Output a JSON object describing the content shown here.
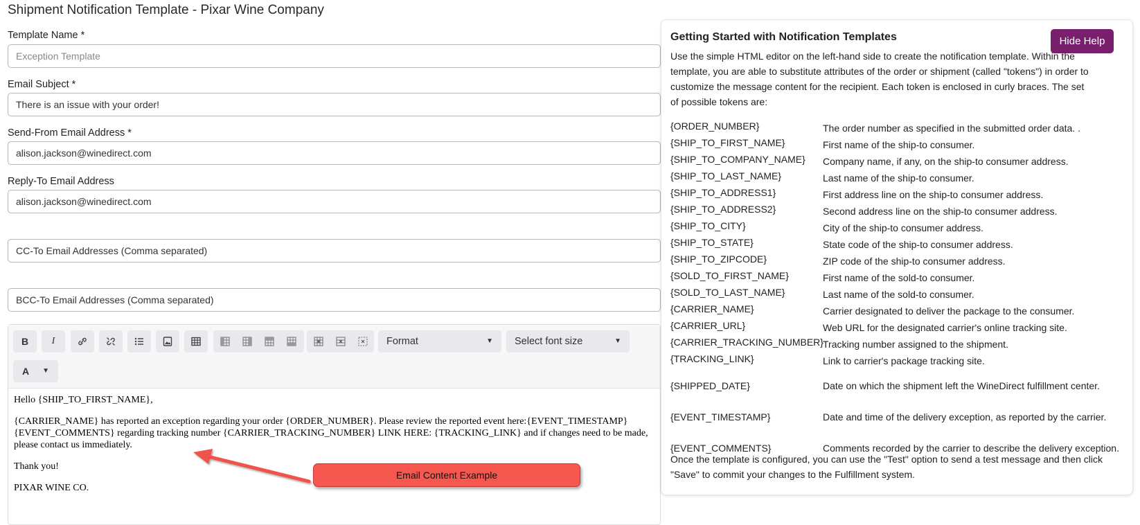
{
  "page": {
    "title": "Shipment Notification Template - Pixar Wine Company"
  },
  "form": {
    "template_name": {
      "label": "Template Name *",
      "placeholder": "Exception Template"
    },
    "email_subject": {
      "label": "Email Subject *",
      "value": "There is an issue with your order!"
    },
    "send_from": {
      "label": "Send-From Email Address *",
      "value": "alison.jackson@winedirect.com"
    },
    "reply_to": {
      "label": "Reply-To Email Address",
      "value": "alison.jackson@winedirect.com"
    },
    "cc": {
      "placeholder": "CC-To Email Addresses (Comma separated)"
    },
    "bcc": {
      "placeholder": "BCC-To Email Addresses (Comma separated)"
    }
  },
  "editor": {
    "toolbar": {
      "bold": "B",
      "italic": "I",
      "format_select": "Format",
      "font_size_select": "Select font size",
      "text_color": "A",
      "icons": [
        "bold-icon",
        "italic-icon",
        "link-icon",
        "unlink-icon",
        "bulleted-list-icon",
        "image-icon",
        "table-icon",
        "column-insert-before-icon",
        "column-insert-after-icon",
        "row-insert-before-icon",
        "row-insert-after-icon",
        "column-delete-icon",
        "row-delete-icon",
        "table-delete-icon",
        "text-color-icon"
      ]
    },
    "content": {
      "greeting": "Hello {SHIP_TO_FIRST_NAME},",
      "body": "{CARRIER_NAME} has reported an exception regarding your order {ORDER_NUMBER}. Please review the reported event here:{EVENT_TIMESTAMP} {EVENT_COMMENTS} regarding tracking number {CARRIER_TRACKING_NUMBER} LINK HERE: {TRACKING_LINK} and if changes need to be made, please contact us immediately.",
      "thanks": "Thank you!",
      "signature": "PIXAR WINE CO."
    }
  },
  "annotation": {
    "label": "Email Content Example",
    "color": "#f6574f"
  },
  "help": {
    "title": "Getting Started with Notification Templates",
    "hide_button": "Hide Help",
    "button_color": "#7a1f6e",
    "intro": "Use the simple HTML editor on the left-hand side to create the notification template. Within the template, you are able to substitute attributes of the order or shipment (called \"tokens\") in order to customize the message content for the recipient. Each token is enclosed in curly braces. The set of possible tokens are:",
    "tokens": [
      {
        "name": "{ORDER_NUMBER}",
        "desc": "The order number as specified in the submitted order data. ."
      },
      {
        "name": "{SHIP_TO_FIRST_NAME}",
        "desc": "First name of the ship-to consumer."
      },
      {
        "name": "{SHIP_TO_COMPANY_NAME}",
        "desc": "Company name, if any, on the ship-to consumer address."
      },
      {
        "name": "{SHIP_TO_LAST_NAME}",
        "desc": "Last name of the ship-to consumer."
      },
      {
        "name": "{SHIP_TO_ADDRESS1}",
        "desc": "First address line on the ship-to consumer address."
      },
      {
        "name": "{SHIP_TO_ADDRESS2}",
        "desc": "Second address line on the ship-to consumer address."
      },
      {
        "name": "{SHIP_TO_CITY}",
        "desc": "City of the ship-to consumer address."
      },
      {
        "name": "{SHIP_TO_STATE}",
        "desc": "State code of the ship-to consumer address."
      },
      {
        "name": "{SHIP_TO_ZIPCODE}",
        "desc": "ZIP code of the ship-to consumer address."
      },
      {
        "name": "{SOLD_TO_FIRST_NAME}",
        "desc": "First name of the sold-to consumer."
      },
      {
        "name": "{SOLD_TO_LAST_NAME}",
        "desc": "Last name of the sold-to consumer."
      },
      {
        "name": "{CARRIER_NAME}",
        "desc": "Carrier designated to deliver the package to the consumer."
      },
      {
        "name": "{CARRIER_URL}",
        "desc": "Web URL for the designated carrier's online tracking site."
      },
      {
        "name": "{CARRIER_TRACKING_NUMBER}",
        "desc": "Tracking number assigned to the shipment."
      },
      {
        "name": "{TRACKING_LINK}",
        "desc": "Link to carrier's package tracking site."
      },
      {
        "name": "{SHIPPED_DATE}",
        "desc": "Date on which the shipment left the WineDirect fulfillment center."
      },
      {
        "name": "{EVENT_TIMESTAMP}",
        "desc": "Date and time of the delivery exception, as reported by the carrier."
      },
      {
        "name": "{EVENT_COMMENTS}",
        "desc": "Comments recorded by the carrier to describe the delivery exception."
      }
    ],
    "footer": "Once the template is configured, you can use the \"Test\" option to send a test message and then click \"Save\" to commit your changes to the Fulfillment system."
  }
}
